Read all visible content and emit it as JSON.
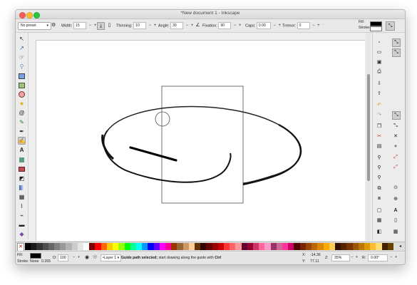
{
  "window": {
    "title": "*New document 1 - Inkscape"
  },
  "toolbar": {
    "preset": "No preset",
    "width_label": "Width:",
    "width_value": "15",
    "thinning_label": "Thinning:",
    "thinning_value": "10",
    "angle_label": "Angle:",
    "angle_value": "30",
    "fixation_label": "Fixation:",
    "fixation_value": "90",
    "caps_label": "Caps:",
    "caps_value": "0.00",
    "tremor_label": "Tremor:",
    "tremor_value": "0",
    "minus": "−",
    "plus": "+",
    "fill_label": "Fill:",
    "stroke_label": "Stroke:"
  },
  "palette": {
    "colors": [
      "#000000",
      "#1a1a1a",
      "#333333",
      "#4d4d4d",
      "#666666",
      "#808080",
      "#999999",
      "#b3b3b3",
      "#cccccc",
      "#e6e6e6",
      "#ffffff",
      "#800000",
      "#ff0000",
      "#ff6600",
      "#ffcc00",
      "#ffff00",
      "#99ff00",
      "#00ff00",
      "#00ff99",
      "#00ffff",
      "#0099ff",
      "#0000ff",
      "#6600ff",
      "#ff00ff",
      "#ff0099",
      "#993300",
      "#996633",
      "#cc9966",
      "#ffcc99",
      "#663300",
      "#330000",
      "#660000",
      "#990000",
      "#cc0000",
      "#ff3333",
      "#ff6666",
      "#ff9999",
      "#660033",
      "#990033",
      "#cc3366",
      "#ff6699",
      "#ff99cc",
      "#993366",
      "#cc6699",
      "#ff3399",
      "#cc0066",
      "#550000",
      "#772200",
      "#994400",
      "#bb6600",
      "#dd8800",
      "#ffaa00",
      "#ffcc55",
      "#331100",
      "#552200",
      "#773300",
      "#995500",
      "#bb7700",
      "#dd9900",
      "#ffbb33",
      "#ffdd77",
      "#442200",
      "#664400"
    ]
  },
  "status": {
    "fill_label": "Fill:",
    "stroke_label": "Stroke:",
    "stroke_value": "None",
    "stroke_width": "0.265",
    "opacity_label": "O:",
    "opacity_value": "100",
    "layer": "•Layer 1",
    "message_bold": "Guide path selected;",
    "message_rest": " start drawing along the guide with ",
    "message_key": "Ctrl",
    "x_label": "X:",
    "x_value": "-14.36",
    "y_label": "Y:",
    "y_value": "77.11",
    "z_label": "Z:",
    "z_value": "35%",
    "r_label": "R:",
    "r_value": "0.00°"
  }
}
